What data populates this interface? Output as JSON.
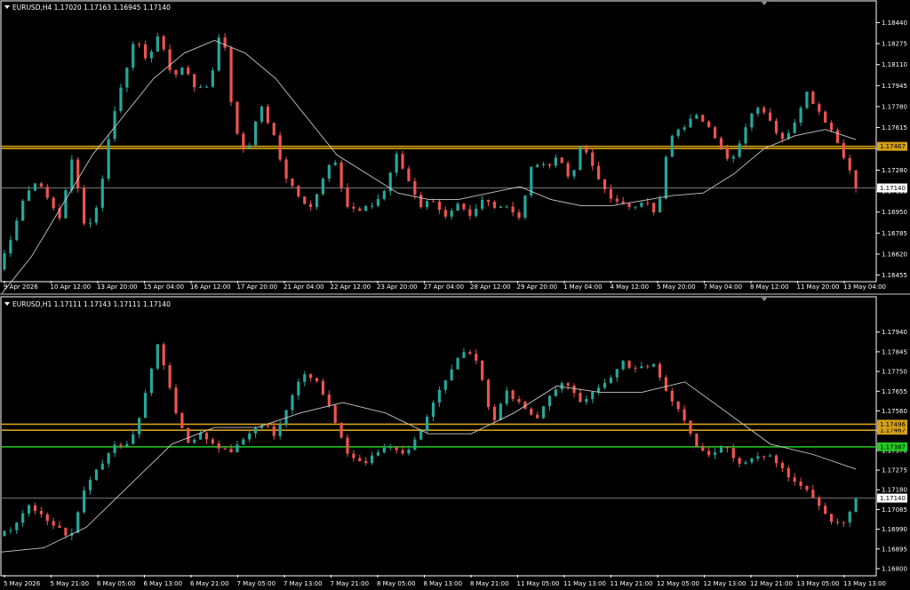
{
  "colors": {
    "bull": "#26a69a",
    "bear": "#ef5350",
    "ma": "#c8c8c8",
    "level": "#d4a017",
    "support": "#22cc22",
    "bg": "#000000",
    "frame": "#ffffff"
  },
  "chart_data": [
    {
      "type": "candlestick",
      "title": "EURUSD,H4  1.17020 1.17163 1.16945 1.17140",
      "ylim": [
        1.1641,
        1.1852
      ],
      "price_ticks": [
        "1.18440",
        "1.18275",
        "1.18110",
        "1.17945",
        "1.17780",
        "1.17615",
        "1.17450",
        "1.17280",
        "1.17115",
        "1.16950",
        "1.16785",
        "1.16620",
        "1.16455"
      ],
      "time_labels": [
        "9 Apr 2026",
        "10 Apr 12:00",
        "13 Apr 20:00",
        "15 Apr 04:00",
        "16 Apr 12:00",
        "17 Apr 20:00",
        "21 Apr 04:00",
        "22 Apr 12:00",
        "23 Apr 20:00",
        "27 Apr 04:00",
        "28 Apr 12:00",
        "29 Apr 20:00",
        "1 May 04:00",
        "4 May 12:00",
        "5 May 20:00",
        "7 May 04:00",
        "8 May 12:00",
        "11 May 20:00",
        "13 May 04:00"
      ],
      "levels": [
        {
          "value": 1.17467,
          "label": "1.17467",
          "kind": "resistance"
        },
        {
          "value": 1.1745,
          "label": "",
          "kind": "resistance"
        }
      ],
      "current_price": {
        "value": 1.1714,
        "label": "1.17140"
      },
      "anchors": [
        1.165,
        1.1675,
        1.1705,
        1.172,
        1.1705,
        1.169,
        1.174,
        1.168,
        1.17,
        1.176,
        1.18,
        1.183,
        1.1815,
        1.1835,
        1.18,
        1.181,
        1.179,
        1.1795,
        1.1845,
        1.176,
        1.174,
        1.178,
        1.176,
        1.1725,
        1.171,
        1.1695,
        1.172,
        1.174,
        1.17,
        1.1695,
        1.17,
        1.171,
        1.174,
        1.172,
        1.17,
        1.1705,
        1.169,
        1.17,
        1.169,
        1.1705,
        1.17,
        1.17,
        1.169,
        1.1735,
        1.173,
        1.174,
        1.172,
        1.175,
        1.1725,
        1.171,
        1.17,
        1.17,
        1.1705,
        1.169,
        1.1755,
        1.176,
        1.1775,
        1.1765,
        1.1745,
        1.1735,
        1.176,
        1.178,
        1.177,
        1.175,
        1.1765,
        1.179,
        1.1775,
        1.176,
        1.174,
        1.1714
      ],
      "ma": [
        1.163,
        1.166,
        1.17,
        1.174,
        1.177,
        1.18,
        1.182,
        1.183,
        1.182,
        1.18,
        1.177,
        1.174,
        1.1725,
        1.171,
        1.1705,
        1.1705,
        1.171,
        1.1715,
        1.1705,
        1.17,
        1.17,
        1.1704,
        1.1708,
        1.171,
        1.1725,
        1.1745,
        1.1755,
        1.176,
        1.1752
      ],
      "n": 140
    },
    {
      "type": "candlestick",
      "title": "EURUSD,H1  1.17111 1.17143 1.17111 1.17140",
      "ylim": [
        1.1677,
        1.1805
      ],
      "price_ticks": [
        "1.17940",
        "1.17845",
        "1.17750",
        "1.17655",
        "1.17560",
        "1.17465",
        "1.17370",
        "1.17275",
        "1.17180",
        "1.17085",
        "1.16990",
        "1.16895",
        "1.16800"
      ],
      "time_labels": [
        "5 May 2026",
        "5 May 21:00",
        "6 May 05:00",
        "6 May 13:00",
        "6 May 21:00",
        "7 May 05:00",
        "7 May 13:00",
        "7 May 21:00",
        "8 May 05:00",
        "8 May 13:00",
        "8 May 21:00",
        "11 May 05:00",
        "11 May 13:00",
        "11 May 21:00",
        "12 May 05:00",
        "12 May 13:00",
        "12 May 21:00",
        "13 May 05:00",
        "13 May 13:00"
      ],
      "levels": [
        {
          "value": 1.17467,
          "label": "1.17467",
          "kind": "resistance"
        },
        {
          "value": 1.17496,
          "label": "1.17496",
          "kind": "resistance"
        },
        {
          "value": 1.17387,
          "label": "1.17387",
          "kind": "support"
        }
      ],
      "current_price": {
        "value": 1.1714,
        "label": "1.17140"
      },
      "anchors": [
        1.1695,
        1.17,
        1.171,
        1.1705,
        1.17,
        1.1695,
        1.172,
        1.173,
        1.174,
        1.174,
        1.176,
        1.179,
        1.176,
        1.174,
        1.1745,
        1.174,
        1.1735,
        1.1745,
        1.175,
        1.1745,
        1.176,
        1.1775,
        1.177,
        1.1755,
        1.1735,
        1.173,
        1.1735,
        1.174,
        1.1735,
        1.1745,
        1.176,
        1.1775,
        1.1785,
        1.178,
        1.175,
        1.1765,
        1.176,
        1.175,
        1.1765,
        1.177,
        1.176,
        1.1765,
        1.177,
        1.178,
        1.1775,
        1.178,
        1.1765,
        1.1755,
        1.174,
        1.1735,
        1.174,
        1.173,
        1.1735,
        1.1735,
        1.1728,
        1.172,
        1.1715,
        1.1705,
        1.17,
        1.1714
      ],
      "ma": [
        1.1688,
        1.169,
        1.17,
        1.172,
        1.174,
        1.1748,
        1.1748,
        1.1755,
        1.176,
        1.1755,
        1.1745,
        1.1745,
        1.1755,
        1.1768,
        1.1765,
        1.1765,
        1.177,
        1.1755,
        1.174,
        1.1735,
        1.1728
      ],
      "n": 140
    }
  ]
}
